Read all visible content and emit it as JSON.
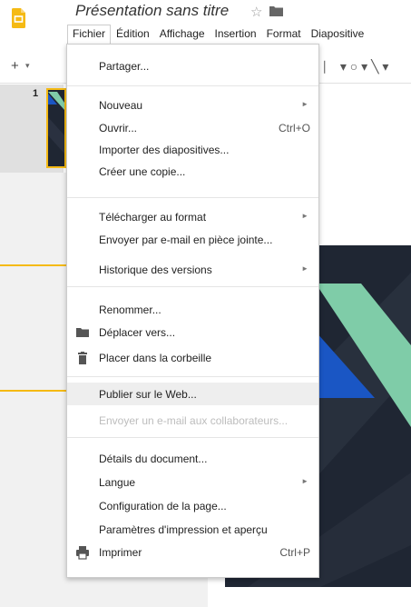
{
  "header": {
    "doc_title": "Présentation sans titre",
    "star": "☆",
    "menus": [
      "Fichier",
      "Édition",
      "Affichage",
      "Insertion",
      "Format",
      "Diapositive"
    ]
  },
  "toolbar": {
    "plus": "+",
    "caret": "▾",
    "right_tools": "⎸ ▾ ○ ▾ ╲ ▾"
  },
  "filmstrip": {
    "slide_number": "1"
  },
  "file_menu": {
    "items": [
      {
        "label": "Partager...",
        "shortcut": "",
        "submenu": false
      },
      {
        "label": "Nouveau",
        "shortcut": "",
        "submenu": true
      },
      {
        "label": "Ouvrir...",
        "shortcut": "Ctrl+O",
        "submenu": false
      },
      {
        "label": "Importer des diapositives...",
        "shortcut": "",
        "submenu": false
      },
      {
        "label": "Créer une copie...",
        "shortcut": "",
        "submenu": false
      },
      {
        "label": "Télécharger au format",
        "shortcut": "",
        "submenu": true
      },
      {
        "label": "Envoyer par e-mail en pièce jointe...",
        "shortcut": "",
        "submenu": false
      },
      {
        "label": "Historique des versions",
        "shortcut": "",
        "submenu": true
      },
      {
        "label": "Renommer...",
        "shortcut": "",
        "submenu": false
      },
      {
        "label": "Déplacer vers...",
        "shortcut": "",
        "submenu": false,
        "icon": "folder-icon"
      },
      {
        "label": "Placer dans la corbeille",
        "shortcut": "",
        "submenu": false,
        "icon": "trash-icon"
      },
      {
        "label": "Publier sur le Web...",
        "shortcut": "",
        "submenu": false,
        "highlighted": true
      },
      {
        "label": "Envoyer un e-mail aux collaborateurs...",
        "shortcut": "",
        "submenu": false,
        "disabled": true
      },
      {
        "label": "Détails du document...",
        "shortcut": "",
        "submenu": false
      },
      {
        "label": "Langue",
        "shortcut": "",
        "submenu": true
      },
      {
        "label": "Configuration de la page...",
        "shortcut": "",
        "submenu": false
      },
      {
        "label": "Paramètres d'impression et aperçu",
        "shortcut": "",
        "submenu": false
      },
      {
        "label": "Imprimer",
        "shortcut": "Ctrl+P",
        "submenu": false,
        "icon": "printer-icon"
      }
    ],
    "submenu_arrow": "►"
  },
  "colors": {
    "logo": "#f5ba14",
    "annotation": "#f5ba14",
    "slide_bg": "#1f2633",
    "slide_blue": "#1a56c4",
    "slide_green": "#7fcca8"
  }
}
